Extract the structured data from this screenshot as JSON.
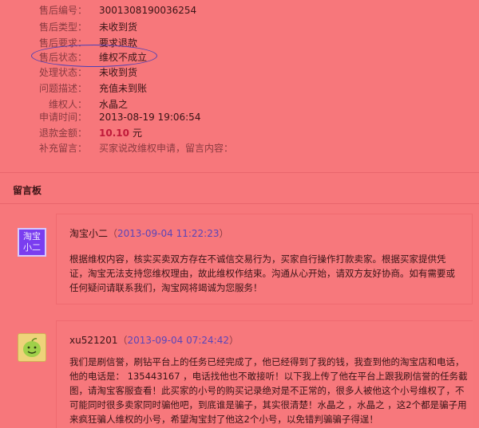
{
  "detail": {
    "rows": [
      {
        "label": "售后编号：",
        "value": "3001308190036254"
      },
      {
        "label": "售后类型：",
        "value": "未收到货"
      },
      {
        "label": "售后要求：",
        "value": "要求退款"
      },
      {
        "label": "售后状态：",
        "value": "维权不成立"
      },
      {
        "label": "处理状态：",
        "value": "未收到货"
      },
      {
        "label": "问题描述：",
        "value": "充值未到账"
      },
      {
        "label": "维权人：",
        "value": "水晶之"
      },
      {
        "label": "申请时间：",
        "value": "2013-08-19 19:06:54"
      },
      {
        "label": "退款金额：",
        "value": "10.10",
        "unit": "元"
      },
      {
        "label": "补充留言：",
        "value": "买家说改维权申请，留言内容："
      }
    ],
    "highlight_color": "#4a3fb5"
  },
  "board": {
    "title": "留言板",
    "messages": [
      {
        "avatar_text_line1": "淘宝",
        "avatar_text_line2": "小二",
        "author": "淘宝小二",
        "time": "2013-09-04 11:22:23",
        "body": "根据维权内容，核实买卖双方存在不诚信交易行为，买家自行操作打款卖家。根据买家提供凭证，淘宝无法支持您维权理由，故此维权作结束。沟通从心开始，请双方友好协商。如有需要或任何疑问请联系我们，淘宝网将竭诚为您服务！"
      },
      {
        "author": "xu521201",
        "time": "2013-09-04 07:24:42",
        "body": "我们是刷信誉，刷钻平台上的任务已经完成了，他已经得到了我的钱，我查到他的淘宝店和电话，他的电话是：  135443167    ，电话找他也不敢接听！以下我上传了他在平台上跟我刷信誉的任务截图，请淘宝客服查看！此买家的小号的购买记录绝对是不正常的，很多人被他这个小号维权了，不可能同时很多卖家同时骗他吧，到底谁是骗子，其实很清楚！水晶之   ，水晶之   ，这2个都是骗子用来疯狂骗人维权的小号，希望淘宝封了他这2个小号，以免错判骗骗子得逞！"
      }
    ]
  },
  "colors": {
    "background": "#f7777b",
    "time_color": "#5b45b8",
    "money_color": "#c01a3a"
  }
}
